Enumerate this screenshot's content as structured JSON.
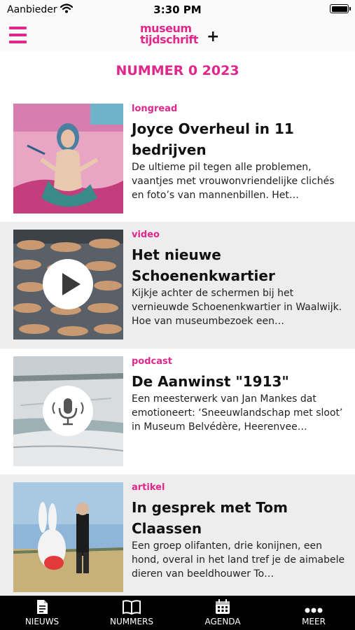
{
  "status": {
    "carrier": "Aanbieder",
    "time": "3:30 PM"
  },
  "header": {
    "logo_line1": "museum",
    "logo_line2": "tijdschrift",
    "logo_plus": "+",
    "menu_icon": "hamburger-menu-icon",
    "accent_color": "#e0278c"
  },
  "issue": {
    "title": "NUMMER 0 2023"
  },
  "articles": [
    {
      "category": "longread",
      "title": "Joyce Overheul in 11 bedrijven",
      "summary": "De ultieme pil tegen alle problemen, vaantjes met vrouwonvriendelijke clichés en foto’s van mannenbillen. Het…"
    },
    {
      "category": "video",
      "title": "Het nieuwe Schoenenkwartier",
      "summary": "Kijkje achter de schermen bij het vernieuwde Schoenenkwartier in Waalwijk. Hoe van museumbezoek een…",
      "overlay_icon": "play-icon"
    },
    {
      "category": "podcast",
      "title": "De Aanwinst \"1913\"",
      "summary": "Een meesterwerk van Jan Mankes dat emotioneert: ‘Sneeuwlandschap met sloot’ in Museum Belvédère, Heerenvee…",
      "overlay_icon": "microphone-icon"
    },
    {
      "category": "artikel",
      "title": "In gesprek met Tom Claassen",
      "summary": "Een groep olifanten, drie konijnen, een hond, overal in het land tref je de aimabele dieren van beeldhouwer To…"
    }
  ],
  "tabbar": {
    "items": [
      {
        "label": "NIEUWS",
        "icon": "document-icon"
      },
      {
        "label": "NUMMERS",
        "icon": "book-icon"
      },
      {
        "label": "AGENDA",
        "icon": "calendar-icon"
      },
      {
        "label": "MEER",
        "icon": "more-dots-icon"
      }
    ]
  }
}
